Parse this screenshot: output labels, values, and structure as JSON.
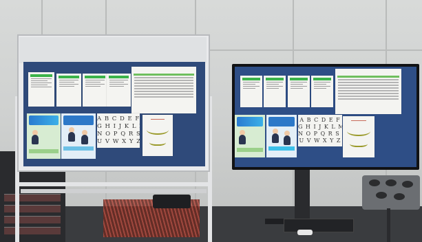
{
  "scene": {
    "description_tags": [
      "whiteboard",
      "monitor",
      "posters"
    ],
    "colors": {
      "board_blue": "#2f4a7a",
      "screen_blue": "#2e4e86",
      "poster_green": "#3cb34a",
      "flyer_blue": "#2a7bd0"
    }
  },
  "alphabet_poster": {
    "line1": "A B C D E F",
    "line2": "G H I J K L M",
    "line3": "N O P Q R S T",
    "line4": "U V W X Y Z"
  }
}
